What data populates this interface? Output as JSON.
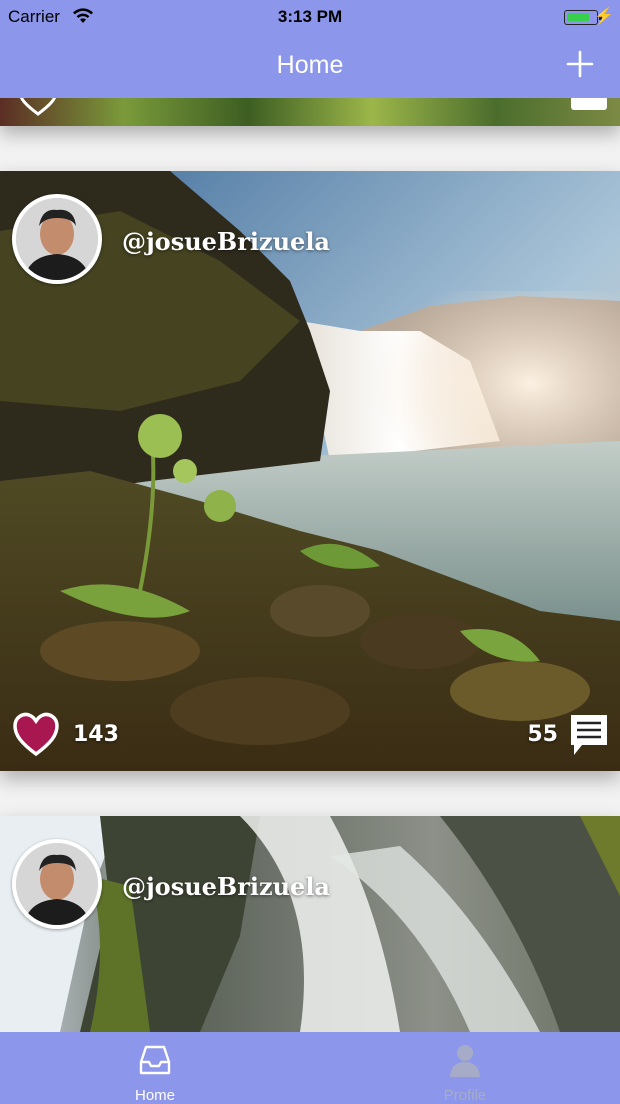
{
  "status_bar": {
    "carrier": "Carrier",
    "time": "3:13 PM",
    "battery_icon": "battery-charging-icon",
    "battery_color": "#38d04b"
  },
  "nav_bar": {
    "title": "Home",
    "add_icon": "plus-icon"
  },
  "colors": {
    "bar_background": "#8c96ea",
    "like_heart": "#a8174f",
    "tab_active": "#ffffff",
    "tab_inactive": "#a6acc8"
  },
  "posts": [
    {
      "username": "@josueBrizuela",
      "likes": "143",
      "comments": "55"
    },
    {
      "username": "@josueBrizuela"
    }
  ],
  "tab_bar": {
    "items": [
      {
        "label": "Home",
        "icon": "inbox-tray-icon",
        "active": true
      },
      {
        "label": "Profile",
        "icon": "person-icon",
        "active": false
      }
    ]
  }
}
